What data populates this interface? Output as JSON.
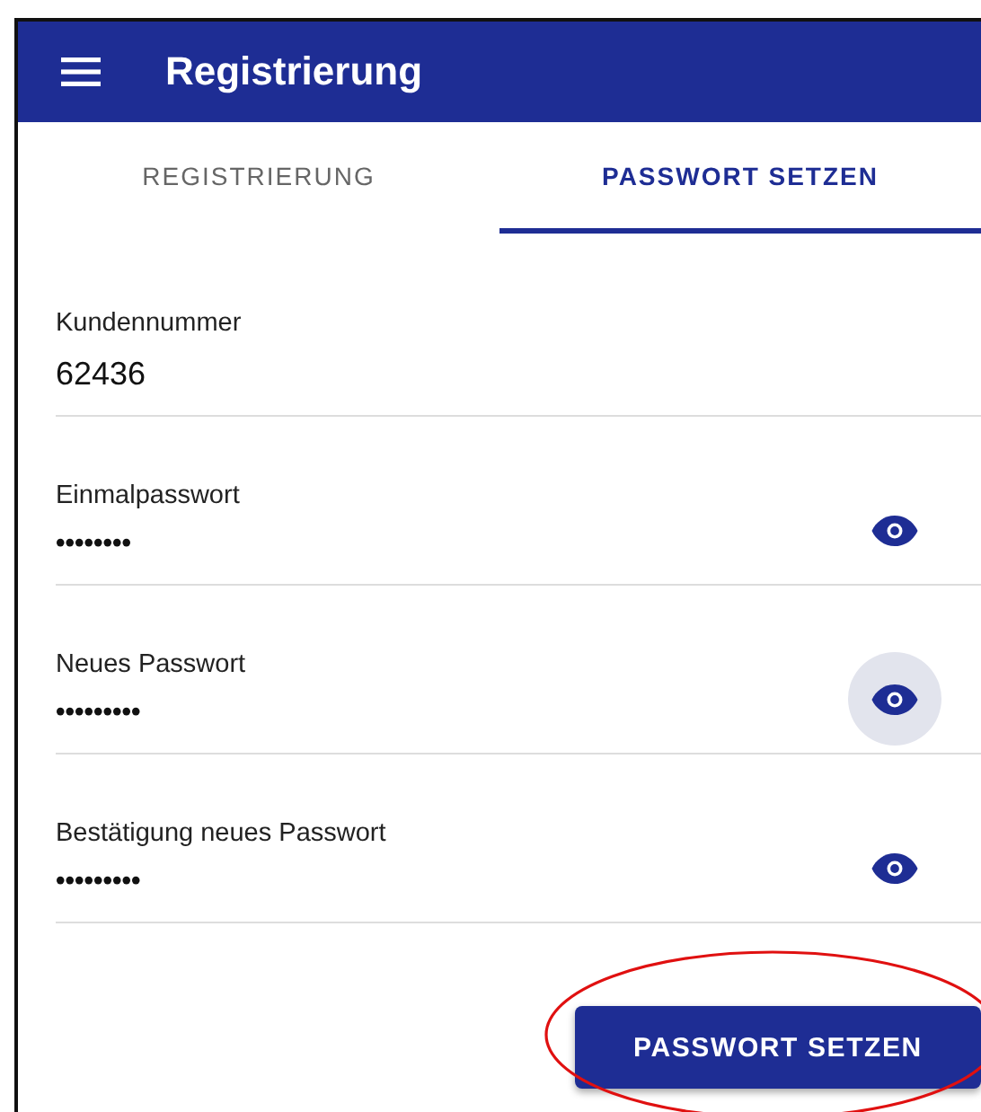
{
  "app_bar": {
    "title": "Registrierung"
  },
  "tabs": [
    {
      "label": "REGISTRIERUNG",
      "selected": false
    },
    {
      "label": "PASSWORT SETZEN",
      "selected": true
    }
  ],
  "fields": [
    {
      "kind": "text",
      "label": "Kundennummer",
      "value": "62436"
    },
    {
      "kind": "password",
      "label": "Einmalpasswort",
      "value": "••••••••",
      "focused": false
    },
    {
      "kind": "password",
      "label": "Neues Passwort",
      "value": "•••••••••",
      "focused": true
    },
    {
      "kind": "password",
      "label": "Bestätigung neues Passwort",
      "value": "•••••••••",
      "focused": false
    }
  ],
  "submit_button": {
    "label": "PASSWORT SETZEN",
    "highlighted": true
  }
}
